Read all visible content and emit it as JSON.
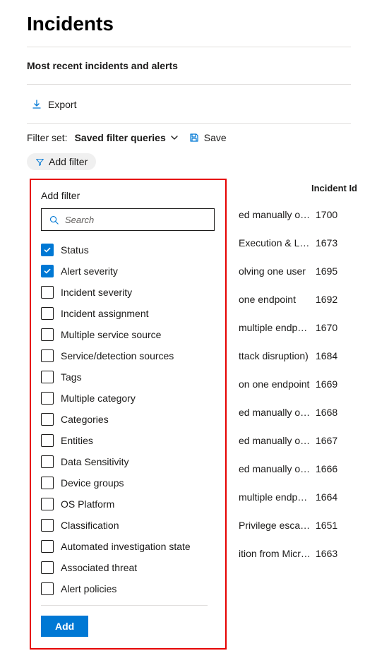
{
  "header": {
    "title": "Incidents",
    "subtitle": "Most recent incidents and alerts"
  },
  "toolbar": {
    "export_label": "Export"
  },
  "filterbar": {
    "label": "Filter set:",
    "selected": "Saved filter queries",
    "save_label": "Save",
    "add_filter_chip": "Add filter"
  },
  "popover": {
    "title": "Add filter",
    "search_placeholder": "Search",
    "add_button": "Add",
    "items": [
      {
        "label": "Status",
        "checked": true
      },
      {
        "label": "Alert severity",
        "checked": true
      },
      {
        "label": "Incident severity",
        "checked": false
      },
      {
        "label": "Incident assignment",
        "checked": false
      },
      {
        "label": "Multiple service source",
        "checked": false
      },
      {
        "label": "Service/detection sources",
        "checked": false
      },
      {
        "label": "Tags",
        "checked": false
      },
      {
        "label": "Multiple category",
        "checked": false
      },
      {
        "label": "Categories",
        "checked": false
      },
      {
        "label": "Entities",
        "checked": false
      },
      {
        "label": "Data Sensitivity",
        "checked": false
      },
      {
        "label": "Device groups",
        "checked": false
      },
      {
        "label": "OS Platform",
        "checked": false
      },
      {
        "label": "Classification",
        "checked": false
      },
      {
        "label": "Automated investigation state",
        "checked": false
      },
      {
        "label": "Associated threat",
        "checked": false
      },
      {
        "label": "Alert policies",
        "checked": false
      }
    ]
  },
  "grid": {
    "columns": {
      "id": "Incident Id"
    },
    "rows": [
      {
        "name": "ed manually on o...",
        "id": "1700"
      },
      {
        "name": "Execution & Late...",
        "id": "1673"
      },
      {
        "name": "olving one user",
        "id": "1695"
      },
      {
        "name": "one endpoint",
        "id": "1692"
      },
      {
        "name": "multiple endpoints",
        "id": "1670"
      },
      {
        "name": "ttack disruption)",
        "id": "1684"
      },
      {
        "name": "on one endpoint",
        "id": "1669"
      },
      {
        "name": "ed manually on o...",
        "id": "1668"
      },
      {
        "name": "ed manually on o...",
        "id": "1667"
      },
      {
        "name": "ed manually on o...",
        "id": "1666"
      },
      {
        "name": "multiple endpoints",
        "id": "1664"
      },
      {
        "name": "Privilege escalati...",
        "id": "1651"
      },
      {
        "name": "ition from Micros...",
        "id": "1663"
      }
    ]
  },
  "colors": {
    "accent": "#0078d4",
    "highlight": "#e60000"
  }
}
